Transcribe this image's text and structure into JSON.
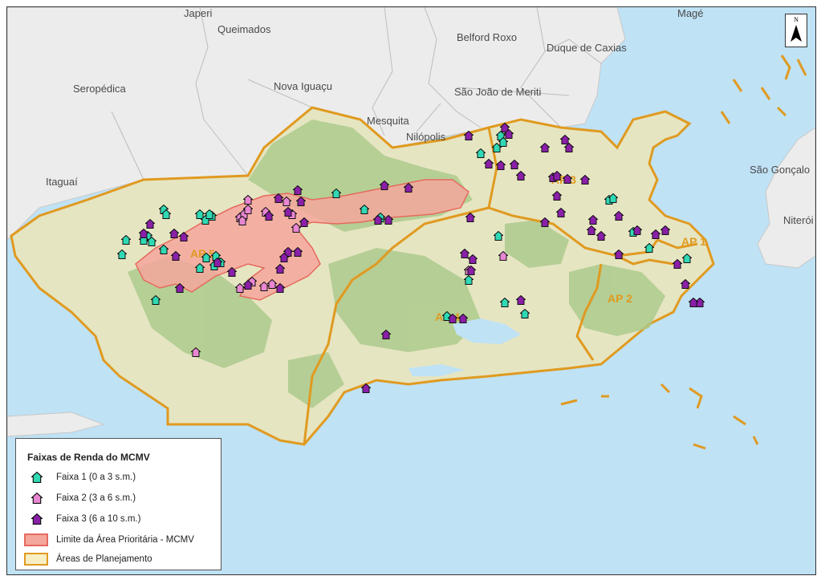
{
  "map": {
    "municipalities": [
      {
        "name": "Japeri"
      },
      {
        "name": "Queimados"
      },
      {
        "name": "Belford Roxo"
      },
      {
        "name": "Magé"
      },
      {
        "name": "Duque de Caxias"
      },
      {
        "name": "Seropédica"
      },
      {
        "name": "Nova Iguaçu"
      },
      {
        "name": "São João de Meriti"
      },
      {
        "name": "Mesquita"
      },
      {
        "name": "Nilópolis"
      },
      {
        "name": "Itaguaí"
      },
      {
        "name": "São Gonçalo"
      },
      {
        "name": "Niterói"
      }
    ],
    "planning_areas": [
      "AP 1",
      "AP 2",
      "AP 3",
      "AP 4",
      "AP 5"
    ],
    "north_label": "N",
    "colors": {
      "sea": "#bfe2f5",
      "neighbor_land": "#ececec",
      "city_land": "#e6e5c2",
      "relief": "#a9c98a",
      "priority_fill": "#f4a79c",
      "priority_stroke": "#e56a5e",
      "planning_border": "#e09a20",
      "faixa1": "#2fd9b4",
      "faixa2": "#e986d2",
      "faixa3": "#8a1fa8"
    }
  },
  "legend": {
    "title": "Faixas de Renda do MCMV",
    "items": [
      {
        "label": "Faixa 1 (0 a 3 s.m.)",
        "icon": "house-icon",
        "color": "#2fd9b4"
      },
      {
        "label": "Faixa 2 (3 a 6 s.m.)",
        "icon": "house-icon",
        "color": "#e986d2"
      },
      {
        "label": "Faixa 3 (6 a 10 s.m.)",
        "icon": "house-icon",
        "color": "#8a1fa8"
      },
      {
        "label": "Limite da Área Prioritária - MCMV",
        "icon": "area-swatch",
        "color": "#f4a79c"
      },
      {
        "label": "Áreas de Planejamento",
        "icon": "area-swatch",
        "color": "#f7eec4"
      }
    ]
  }
}
